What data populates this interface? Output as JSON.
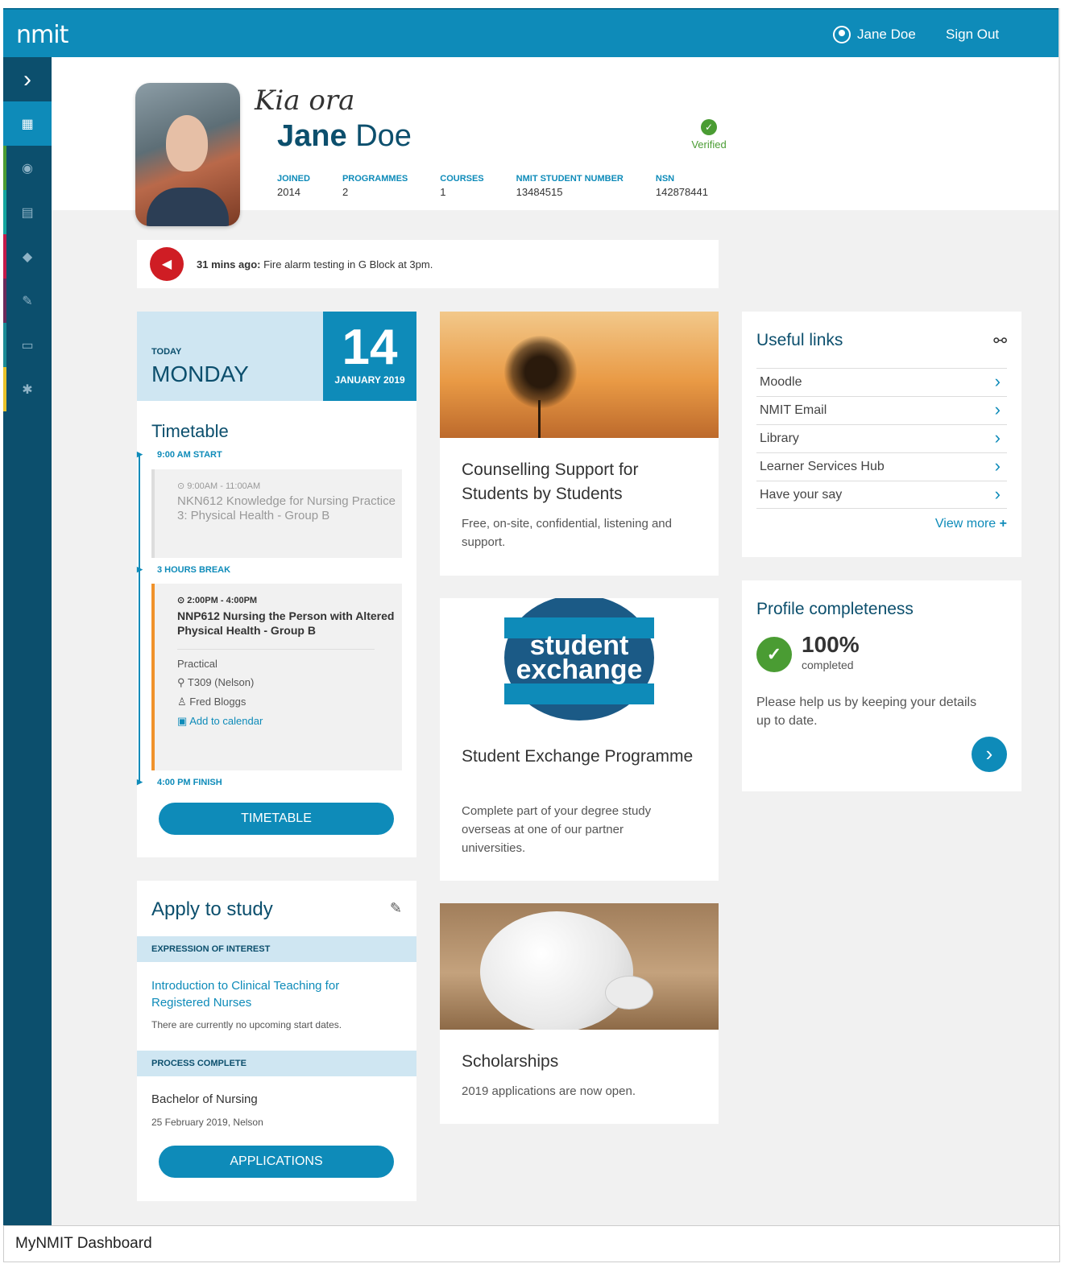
{
  "brand": {
    "logo": "nmit",
    "primary": "#0e8bb9",
    "dark": "#0c4f6d",
    "alert": "#cf1d24",
    "success": "#4a9c33"
  },
  "header": {
    "user": "Jane Doe",
    "signout": "Sign Out"
  },
  "sidebar": {
    "items": [
      {
        "icon": "chevron-right-icon",
        "glyph": "›"
      },
      {
        "icon": "dashboard-grid-icon",
        "glyph": "▦"
      },
      {
        "icon": "profile-icon",
        "glyph": "◉"
      },
      {
        "icon": "calendar-icon",
        "glyph": "▤"
      },
      {
        "icon": "graduation-cap-icon",
        "glyph": "◆"
      },
      {
        "icon": "edit-icon",
        "glyph": "✎"
      },
      {
        "icon": "card-icon",
        "glyph": "▭"
      },
      {
        "icon": "settings-icon",
        "glyph": "✱"
      }
    ]
  },
  "profile": {
    "greeting": "Kia ora",
    "first_name": "Jane",
    "last_name": "Doe",
    "verified": "Verified",
    "stats": [
      {
        "label": "JOINED",
        "value": "2014"
      },
      {
        "label": "PROGRAMMES",
        "value": "2"
      },
      {
        "label": "COURSES",
        "value": "1"
      },
      {
        "label": "NMIT STUDENT NUMBER",
        "value": "13484515"
      },
      {
        "label": "NSN",
        "value": "142878441"
      }
    ]
  },
  "alert": {
    "time": "31 mins ago:",
    "text": " Fire alarm testing in G Block at 3pm."
  },
  "today": {
    "label": "TODAY",
    "day": "MONDAY",
    "date_num": "14",
    "date_month": "JANUARY 2019",
    "timetable_title": "Timetable",
    "start": "9:00 AM START",
    "break": "3 HOURS BREAK",
    "finish": "4:00 PM FINISH",
    "slot1": {
      "time": "9:00AM - 11:00AM",
      "course": "NKN612 Knowledge for Nursing Practice 3: Physical Health - Group B"
    },
    "slot2": {
      "time": "2:00PM - 4:00PM",
      "course": "NNP612 Nursing the Person with Altered Physical Health - Group B",
      "type": "Practical",
      "room": "T309 (Nelson)",
      "tutor": "Fred Bloggs",
      "calendar": "Add to calendar"
    },
    "button": "TIMETABLE"
  },
  "apply": {
    "title": "Apply to study",
    "section1": "EXPRESSION OF INTEREST",
    "link": "Introduction to Clinical Teaching for Registered Nurses",
    "note": "There are currently no upcoming start dates.",
    "section2": "PROCESS COMPLETE",
    "programme": "Bachelor of Nursing",
    "programme_date": "25 February 2019, Nelson",
    "button": "APPLICATIONS"
  },
  "features": [
    {
      "title": "Counselling Support for Students by Students",
      "text": "Free, on-site, confidential, listening and support."
    },
    {
      "logo_line1": "student",
      "logo_line2": "exchange",
      "title": "Student Exchange Programme",
      "text": "Complete part of your degree study overseas at one of our partner universities."
    },
    {
      "title": "Scholarships",
      "text": "2019 applications are now open."
    }
  ],
  "links": {
    "title": "Useful links",
    "items": [
      "Moodle",
      "NMIT Email",
      "Library",
      "Learner Services Hub",
      "Have your say"
    ],
    "more": "View more"
  },
  "completeness": {
    "title": "Profile completeness",
    "percent": "100%",
    "label": "completed",
    "text": "Please help us by keeping your details up to date."
  },
  "caption": "MyNMIT Dashboard"
}
